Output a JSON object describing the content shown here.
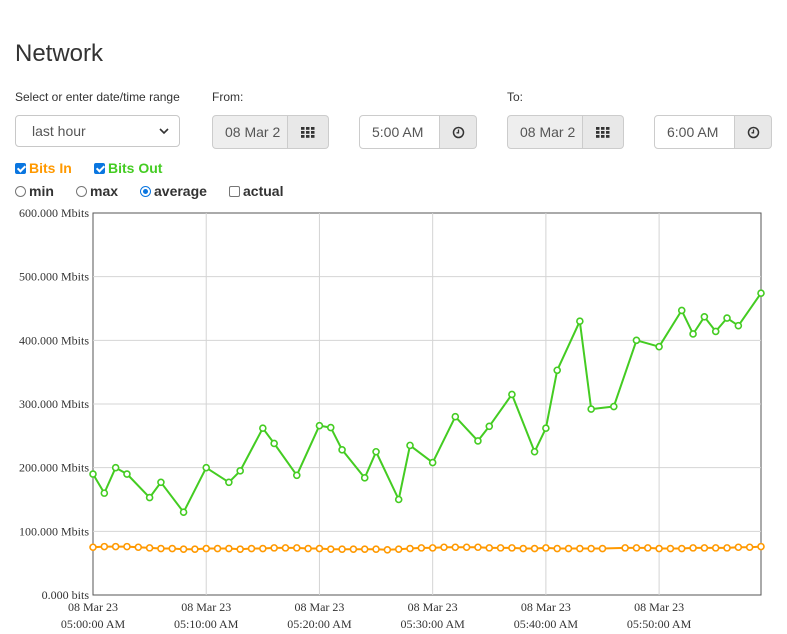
{
  "page": {
    "title": "Network"
  },
  "range": {
    "label": "Select or enter date/time range",
    "selected": "last hour",
    "from_label": "From:",
    "from_date": "08 Mar 2",
    "from_time": "5:00 AM",
    "to_label": "To:",
    "to_date": "08 Mar 2",
    "to_time": "6:00 AM"
  },
  "series_toggles": [
    {
      "label": "Bits In",
      "checked": true,
      "color": "#ff9900"
    },
    {
      "label": "Bits Out",
      "checked": true,
      "color": "#44cc22"
    }
  ],
  "modes": [
    {
      "label": "min",
      "type": "radio",
      "selected": false
    },
    {
      "label": "max",
      "type": "radio",
      "selected": false
    },
    {
      "label": "average",
      "type": "radio",
      "selected": true
    },
    {
      "label": "actual",
      "type": "checkbox",
      "selected": false
    }
  ],
  "chart_data": {
    "type": "line",
    "x": [
      "05:00:00",
      "05:01:00",
      "05:02:00",
      "05:03:00",
      "05:04:00",
      "05:05:00",
      "05:06:00",
      "05:07:00",
      "05:08:00",
      "05:09:00",
      "05:10:00",
      "05:11:00",
      "05:12:00",
      "05:13:00",
      "05:14:00",
      "05:15:00",
      "05:16:00",
      "05:17:00",
      "05:18:00",
      "05:19:00",
      "05:20:00",
      "05:21:00",
      "05:22:00",
      "05:23:00",
      "05:24:00",
      "05:25:00",
      "05:26:00",
      "05:27:00",
      "05:28:00",
      "05:29:00",
      "05:30:00",
      "05:31:00",
      "05:32:00",
      "05:33:00",
      "05:34:00",
      "05:35:00",
      "05:36:00",
      "05:37:00",
      "05:38:00",
      "05:39:00",
      "05:40:00",
      "05:41:00",
      "05:42:00",
      "05:43:00",
      "05:44:00",
      "05:45:00",
      "05:46:00",
      "05:47:00",
      "05:48:00",
      "05:49:00",
      "05:50:00",
      "05:51:00",
      "05:52:00",
      "05:53:00",
      "05:54:00",
      "05:55:00",
      "05:56:00",
      "05:57:00",
      "05:58:00",
      "05:59:00"
    ],
    "x_tick_labels": [
      {
        "t": 0,
        "line1": "08 Mar 23",
        "line2": "05:00:00 AM"
      },
      {
        "t": 10,
        "line1": "08 Mar 23",
        "line2": "05:10:00 AM"
      },
      {
        "t": 20,
        "line1": "08 Mar 23",
        "line2": "05:20:00 AM"
      },
      {
        "t": 30,
        "line1": "08 Mar 23",
        "line2": "05:30:00 AM"
      },
      {
        "t": 40,
        "line1": "08 Mar 23",
        "line2": "05:40:00 AM"
      },
      {
        "t": 50,
        "line1": "08 Mar 23",
        "line2": "05:50:00 AM"
      }
    ],
    "y_tick_labels": [
      "0.000 bits",
      "100.000 Mbits",
      "200.000 Mbits",
      "300.000 Mbits",
      "400.000 Mbits",
      "500.000 Mbits",
      "600.000 Mbits"
    ],
    "ylim": [
      0,
      600
    ],
    "xlim": [
      0,
      59
    ],
    "grid": true,
    "series": [
      {
        "name": "Bits Out",
        "color": "#44cc22",
        "points": [
          [
            0,
            190
          ],
          [
            1,
            160
          ],
          [
            2,
            200
          ],
          [
            3,
            190
          ],
          [
            5,
            153
          ],
          [
            6,
            177
          ],
          [
            8,
            130
          ],
          [
            10,
            200
          ],
          [
            12,
            177
          ],
          [
            13,
            195
          ],
          [
            15,
            262
          ],
          [
            16,
            238
          ],
          [
            18,
            188
          ],
          [
            20,
            266
          ],
          [
            21,
            263
          ],
          [
            22,
            228
          ],
          [
            24,
            184
          ],
          [
            25,
            225
          ],
          [
            27,
            150
          ],
          [
            28,
            235
          ],
          [
            30,
            208
          ],
          [
            32,
            280
          ],
          [
            34,
            242
          ],
          [
            35,
            265
          ],
          [
            37,
            315
          ],
          [
            39,
            225
          ],
          [
            40,
            262
          ],
          [
            41,
            353
          ],
          [
            43,
            430
          ],
          [
            44,
            292
          ],
          [
            46,
            296
          ],
          [
            48,
            400
          ],
          [
            50,
            390
          ],
          [
            52,
            447
          ],
          [
            53,
            410
          ],
          [
            54,
            437
          ],
          [
            55,
            414
          ],
          [
            56,
            435
          ],
          [
            57,
            423
          ],
          [
            59,
            474
          ]
        ]
      },
      {
        "name": "Bits In",
        "color": "#ff9900",
        "points": [
          [
            0,
            75
          ],
          [
            1,
            76
          ],
          [
            2,
            76
          ],
          [
            3,
            76
          ],
          [
            4,
            75
          ],
          [
            5,
            74
          ],
          [
            6,
            73
          ],
          [
            7,
            73
          ],
          [
            8,
            72
          ],
          [
            9,
            72
          ],
          [
            10,
            73
          ],
          [
            11,
            73
          ],
          [
            12,
            73
          ],
          [
            13,
            72
          ],
          [
            14,
            73
          ],
          [
            15,
            73
          ],
          [
            16,
            74
          ],
          [
            17,
            74
          ],
          [
            18,
            74
          ],
          [
            19,
            73
          ],
          [
            20,
            73
          ],
          [
            21,
            72
          ],
          [
            22,
            72
          ],
          [
            23,
            72
          ],
          [
            24,
            72
          ],
          [
            25,
            72
          ],
          [
            26,
            71
          ],
          [
            27,
            72
          ],
          [
            28,
            73
          ],
          [
            29,
            74
          ],
          [
            30,
            74
          ],
          [
            31,
            75
          ],
          [
            32,
            75
          ],
          [
            33,
            75
          ],
          [
            34,
            75
          ],
          [
            35,
            74
          ],
          [
            36,
            74
          ],
          [
            37,
            74
          ],
          [
            38,
            73
          ],
          [
            39,
            73
          ],
          [
            40,
            74
          ],
          [
            41,
            73
          ],
          [
            42,
            73
          ],
          [
            43,
            73
          ],
          [
            44,
            73
          ],
          [
            45,
            73
          ],
          [
            47,
            74
          ],
          [
            48,
            74
          ],
          [
            49,
            74
          ],
          [
            50,
            73
          ],
          [
            51,
            73
          ],
          [
            52,
            73
          ],
          [
            53,
            74
          ],
          [
            54,
            74
          ],
          [
            55,
            74
          ],
          [
            56,
            74
          ],
          [
            57,
            75
          ],
          [
            58,
            75
          ],
          [
            59,
            76
          ]
        ]
      }
    ]
  }
}
